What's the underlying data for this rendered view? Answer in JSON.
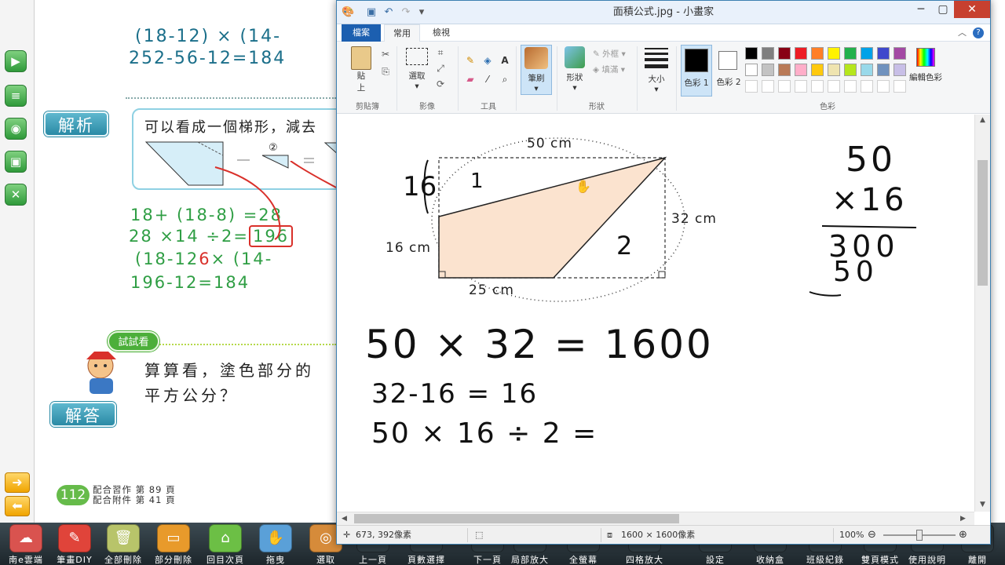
{
  "textbook": {
    "eq_top1": "(18-12) × (14-",
    "eq_top2": "252-56-12=184",
    "analysis_label": "解析",
    "analysis_text": "可以看成一個梯形，減去",
    "circle2": "②",
    "minus": "-",
    "equals": "=",
    "eq_g1": "18+ (18-8) =28",
    "eq_g2a": "28 ×14 ÷2=",
    "eq_g2b": "196",
    "eq_g3a": "(18-12",
    "eq_g3b": "× (14-",
    "eq_g4": "196-12=184",
    "red_six": "6",
    "try_label": "試試看",
    "question_line1": "算算看，塗色部分的",
    "question_line2": "平方公分？",
    "answer_label": "解答",
    "page_number": "112",
    "page_ref_line1": "配合習作 第 89 頁",
    "page_ref_line2": "配合附件 第 41 頁"
  },
  "left_rail": {
    "buttons": [
      "play-icon",
      "note-icon",
      "web-icon",
      "screen-icon",
      "close-icon"
    ],
    "arrows": [
      "➜",
      "⬅"
    ]
  },
  "dock": {
    "items": [
      {
        "label": "南e雲端",
        "icon": "cloud-icon",
        "glyph": "☁",
        "color": "#d9534f"
      },
      {
        "label": "筆畫DIY",
        "icon": "pen-icon",
        "glyph": "✎",
        "color": "#e0443a"
      },
      {
        "label": "全部刪除",
        "icon": "trash-icon",
        "glyph": "🗑",
        "color": "#b8c46a"
      },
      {
        "label": "部分刪除",
        "icon": "eraser-icon",
        "glyph": "▭",
        "color": "#e89a2b"
      },
      {
        "label": "回目次頁",
        "icon": "home-icon",
        "glyph": "⌂",
        "color": "#6cbf45"
      },
      {
        "label": "拖曳",
        "icon": "hand-icon",
        "glyph": "✋",
        "color": "#5aa0d8"
      },
      {
        "label": "選取",
        "icon": "select-icon",
        "glyph": "◎",
        "color": "#d68b3a"
      },
      {
        "label": "上一頁",
        "icon": "prev-page-icon",
        "glyph": "",
        "color": "#2e3a40"
      },
      {
        "label": "頁數選擇",
        "icon": "page-select-icon",
        "glyph": "",
        "color": "#2e3a40"
      },
      {
        "label": "下一頁",
        "icon": "next-page-icon",
        "glyph": "",
        "color": "#2e3a40"
      },
      {
        "label": "局部放大",
        "icon": "zoom-part-icon",
        "glyph": "",
        "color": "#2e3a40"
      },
      {
        "label": "全螢幕",
        "icon": "fullscreen-icon",
        "glyph": "",
        "color": "#2e3a40"
      },
      {
        "label": "四格放大",
        "icon": "quad-zoom-icon",
        "glyph": "",
        "color": "#2e3a40"
      },
      {
        "label": "設定",
        "icon": "settings-icon",
        "glyph": "",
        "color": "#2e3a40"
      },
      {
        "label": "收納盒",
        "icon": "box-icon",
        "glyph": "",
        "color": "#2e3a40"
      },
      {
        "label": "班級紀錄",
        "icon": "record-icon",
        "glyph": "",
        "color": "#2e3a40"
      },
      {
        "label": "雙頁模式",
        "icon": "double-page-icon",
        "glyph": "",
        "color": "#2e3a40"
      },
      {
        "label": "使用說明",
        "icon": "help-icon",
        "glyph": "",
        "color": "#2e3a40"
      },
      {
        "label": "離開",
        "icon": "exit-icon",
        "glyph": "",
        "color": "#2e3a40"
      }
    ]
  },
  "paint": {
    "title": "面積公式.jpg - 小畫家",
    "tabs": {
      "file": "檔案",
      "home": "常用",
      "view": "檢視"
    },
    "clipboard": {
      "paste": "貼",
      "paste2": "上",
      "group": "剪貼簿"
    },
    "image": {
      "select": "選取",
      "group": "影像"
    },
    "tools": {
      "group": "工具"
    },
    "brushes": {
      "label": "筆刷"
    },
    "shapes": {
      "label": "形狀",
      "outline": "外框",
      "fill": "填滿",
      "group": "形狀"
    },
    "size": {
      "label": "大小"
    },
    "colors": {
      "color1": "色彩 1",
      "color2": "色彩 2",
      "edit": "編輯色彩",
      "group": "色彩",
      "color1_value": "#000000",
      "color2_value": "#ffffff",
      "palette_row1": [
        "#000000",
        "#7f7f7f",
        "#880015",
        "#ed1c24",
        "#ff7f27",
        "#fff200",
        "#22b14c",
        "#00a2e8",
        "#3f48cc",
        "#a349a4"
      ],
      "palette_row2": [
        "#ffffff",
        "#c3c3c3",
        "#b97a57",
        "#ffaec9",
        "#ffc90e",
        "#efe4b0",
        "#b5e61d",
        "#99d9ea",
        "#7092be",
        "#c8bfe7"
      ],
      "palette_row3": [
        "#ffffff",
        "#ffffff",
        "#ffffff",
        "#ffffff",
        "#ffffff",
        "#ffffff",
        "#ffffff",
        "#ffffff",
        "#ffffff",
        "#ffffff"
      ]
    },
    "status": {
      "cursor": "673, 392像素",
      "size": "1600 × 1600像素",
      "zoom": "100%"
    },
    "canvas": {
      "top_dim": "50 cm",
      "right_dim": "32 cm",
      "left_dim": "16 cm",
      "bottom_dim": "25 cm",
      "hw_16": "16",
      "hw_1": "1",
      "hw_2": "2",
      "hw_50": "50",
      "hw_x16": "×16",
      "hw_300": "300",
      "hw_50b": "50",
      "hw_eq1": "50 × 32 = 1600",
      "hw_eq2": "32-16 = 16",
      "hw_eq3": "50 × 16 ÷ 2 ="
    }
  }
}
